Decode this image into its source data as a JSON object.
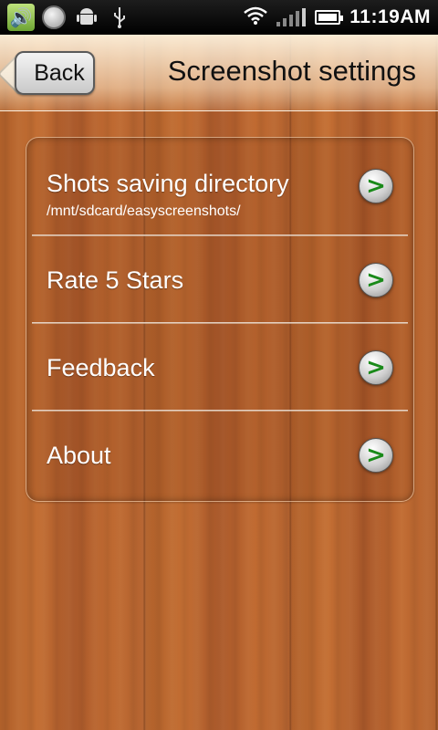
{
  "status_bar": {
    "time": "11:19AM",
    "icons": [
      "volume-icon",
      "circle-icon",
      "android-icon",
      "usb-icon",
      "wifi-icon",
      "signal-icon",
      "battery-icon"
    ]
  },
  "header": {
    "back_label": "Back",
    "title": "Screenshot settings"
  },
  "menu": {
    "items": [
      {
        "label": "Shots saving directory",
        "sublabel": "/mnt/sdcard/easyscreenshots/"
      },
      {
        "label": "Rate 5 Stars"
      },
      {
        "label": "Feedback"
      },
      {
        "label": "About"
      }
    ],
    "chevron_glyph": ">"
  },
  "colors": {
    "chevron_green": "#1a8a1a",
    "wood": "#b5642d"
  }
}
